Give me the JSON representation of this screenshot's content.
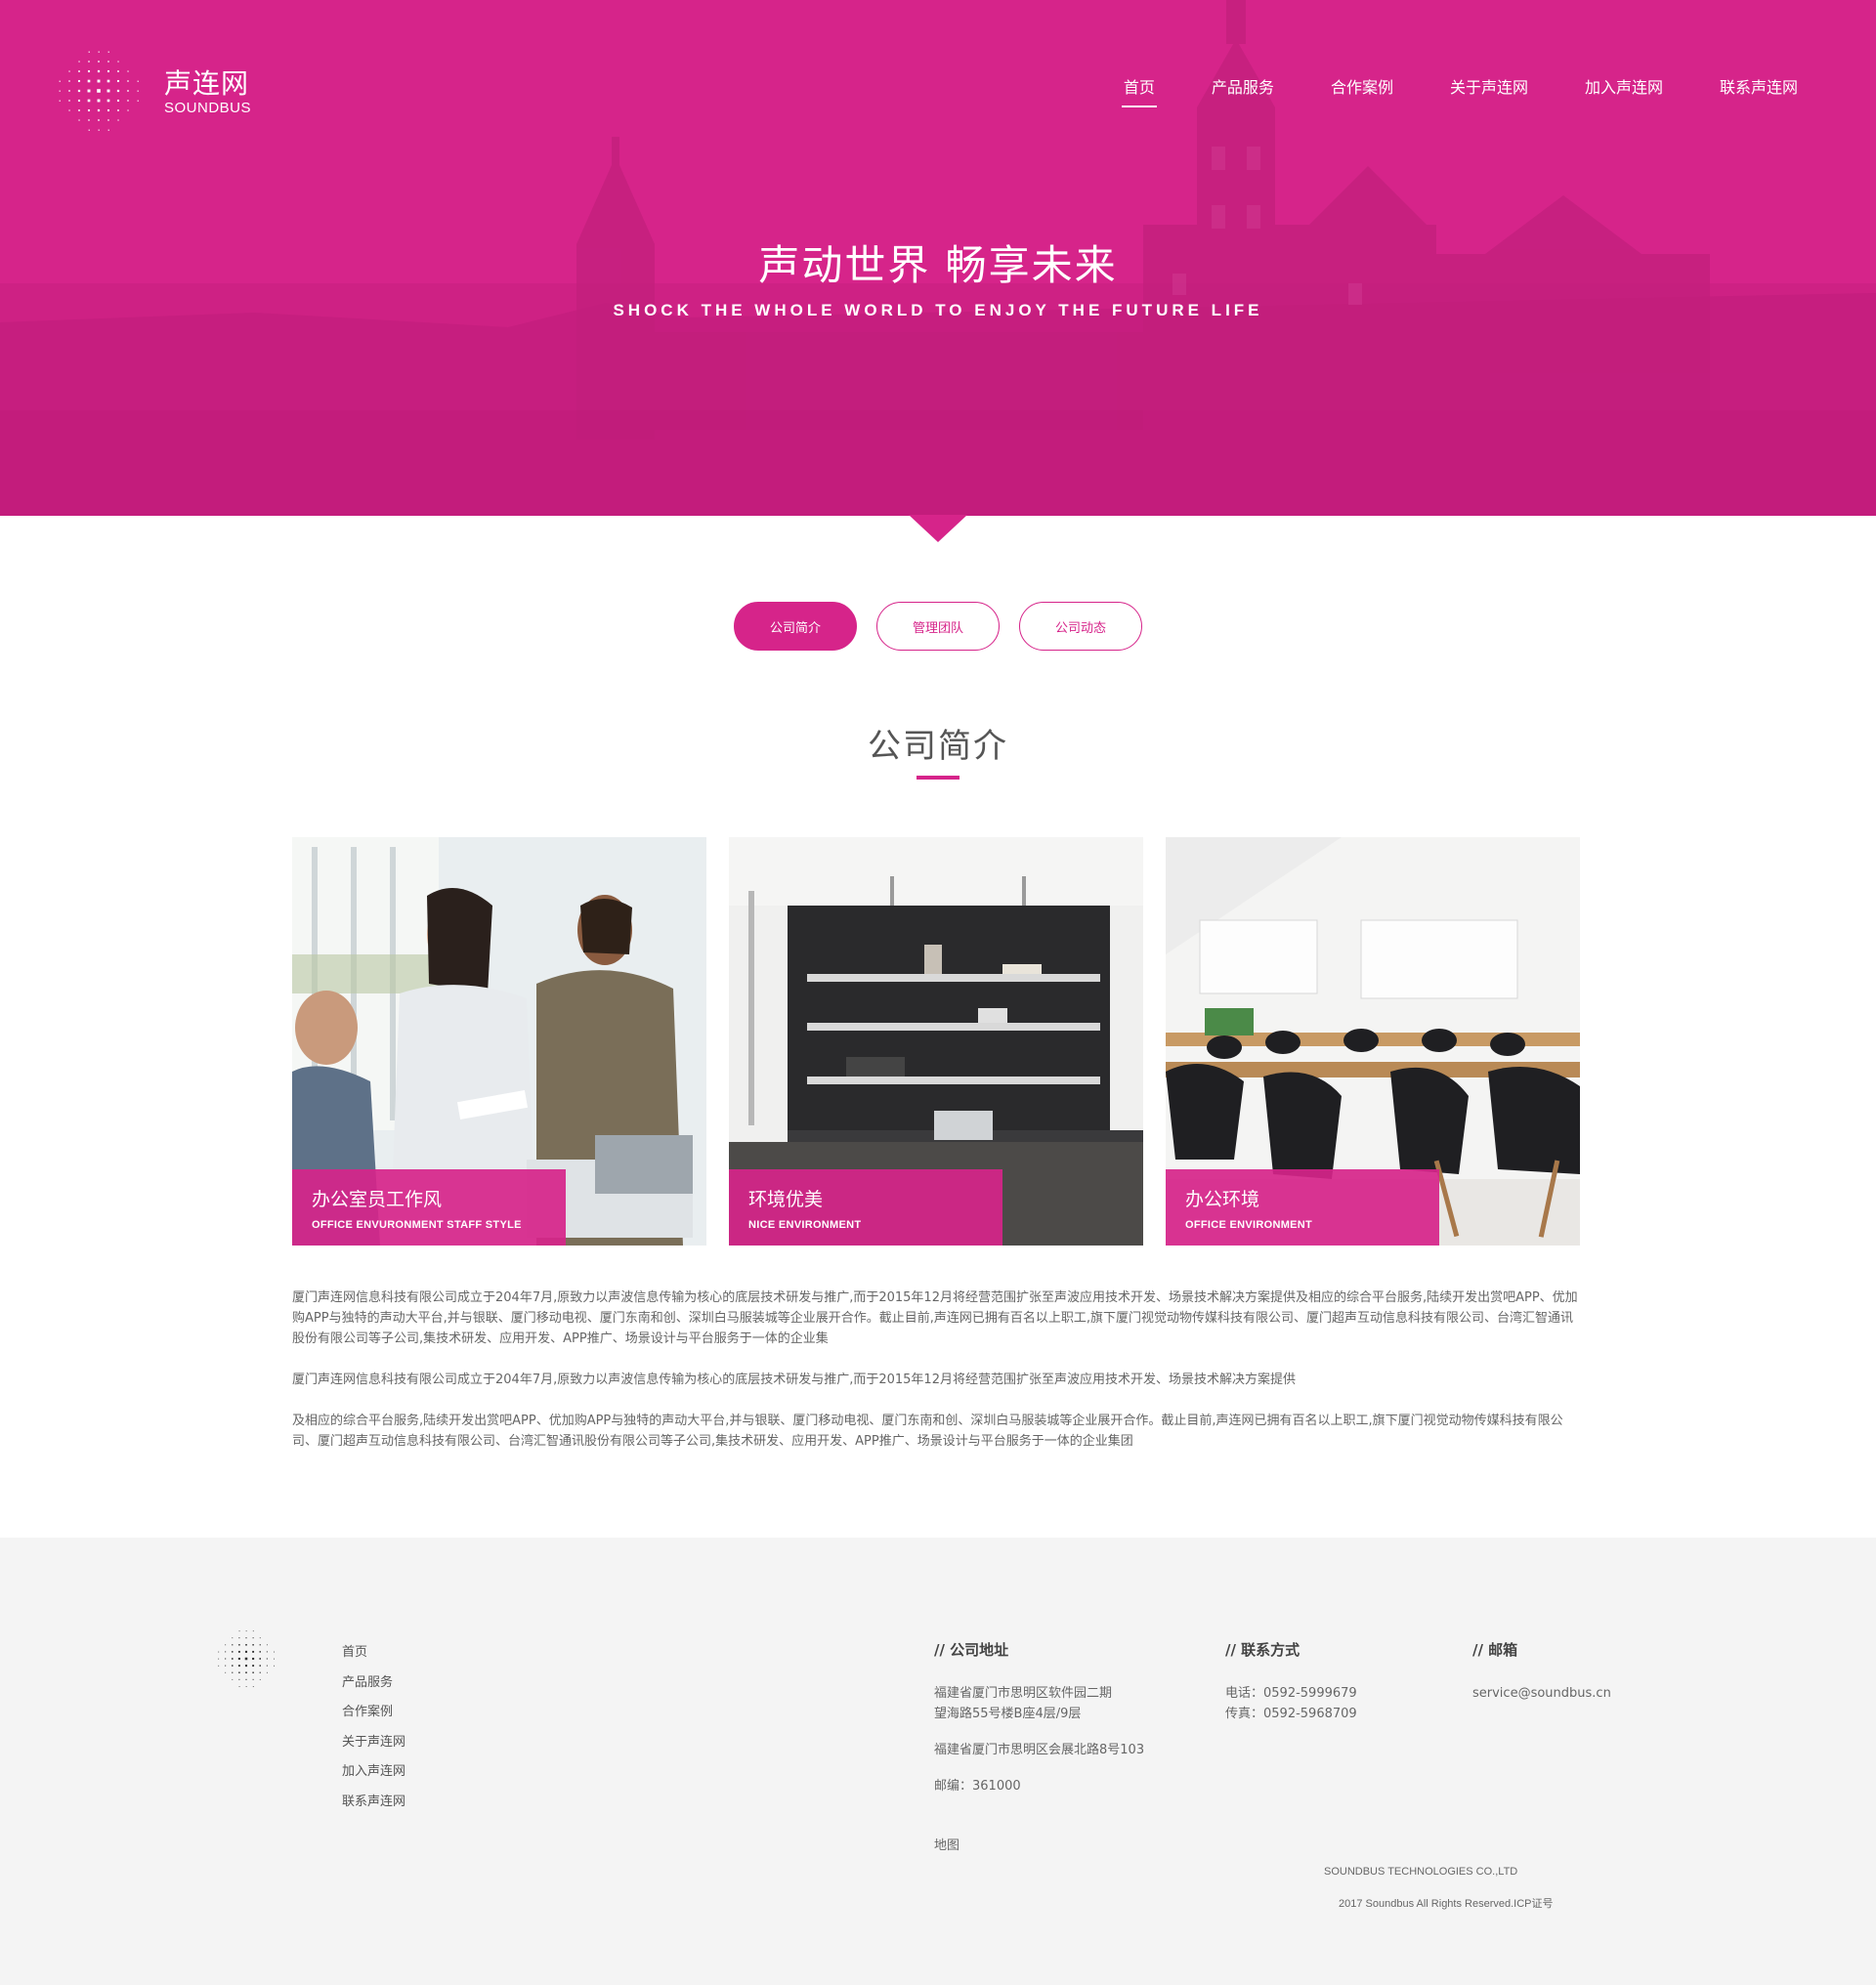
{
  "brand": {
    "name_cn": "声连网",
    "name_en": "SOUNDBUS"
  },
  "nav": [
    {
      "label": "首页",
      "active": true
    },
    {
      "label": "产品服务"
    },
    {
      "label": "合作案例"
    },
    {
      "label": "关于声连网"
    },
    {
      "label": "加入声连网"
    },
    {
      "label": "联系声连网"
    }
  ],
  "hero": {
    "title": "声动世界 畅享未来",
    "subtitle": "SHOCK THE WHOLE WORLD TO  ENJOY THE FUTURE LIFE"
  },
  "tabs": [
    "公司简介",
    "管理团队",
    "公司动态"
  ],
  "section_title": "公司简介",
  "cards": [
    {
      "title": "办公室员工作风",
      "subtitle": "OFFICE ENVURONMENT STAFF STYLE"
    },
    {
      "title": "环境优美",
      "subtitle": "NICE ENVIRONMENT"
    },
    {
      "title": "办公环境",
      "subtitle": "OFFICE ENVIRONMENT"
    }
  ],
  "paragraphs": [
    "厦门声连网信息科技有限公司成立于204年7月,原致力以声波信息传输为核心的底层技术研发与推广,而于2015年12月将经营范围扩张至声波应用技术开发、场景技术解决方案提供及相应的综合平台服务,陆续开发出赏吧APP、优加购APP与独特的声动大平台,并与银联、厦门移动电视、厦门东南和创、深圳白马服装城等企业展开合作。截止目前,声连网已拥有百名以上职工,旗下厦门视觉动物传媒科技有限公司、厦门超声互动信息科技有限公司、台湾汇智通讯股份有限公司等子公司,集技术研发、应用开发、APP推广、场景设计与平台服务于一体的企业集",
    "厦门声连网信息科技有限公司成立于204年7月,原致力以声波信息传输为核心的底层技术研发与推广,而于2015年12月将经营范围扩张至声波应用技术开发、场景技术解决方案提供",
    "及相应的综合平台服务,陆续开发出赏吧APP、优加购APP与独特的声动大平台,并与银联、厦门移动电视、厦门东南和创、深圳白马服装城等企业展开合作。截止目前,声连网已拥有百名以上职工,旗下厦门视觉动物传媒科技有限公司、厦门超声互动信息科技有限公司、台湾汇智通讯股份有限公司等子公司,集技术研发、应用开发、APP推广、场景设计与平台服务于一体的企业集团"
  ],
  "footer": {
    "nav": [
      "首页",
      "产品服务",
      "合作案例",
      "关于声连网",
      "加入声连网",
      "联系声连网"
    ],
    "address": {
      "heading": "// 公司地址",
      "line1": "福建省厦门市思明区软件园二期",
      "line2": "望海路55号楼B座4层/9层",
      "line3": "福建省厦门市思明区会展北路8号103",
      "postcode": "邮编：361000",
      "map": "地图"
    },
    "contact": {
      "heading": "// 联系方式",
      "phone": "电话：0592-5999679",
      "fax": "传真：0592-5968709"
    },
    "email": {
      "heading": "// 邮箱",
      "value": "service@soundbus.cn"
    },
    "company": "SOUNDBUS TECHNOLOGIES CO.,LTD",
    "copyright": "2017 Soundbus All Rights Reserved.ICP证号"
  },
  "colors": {
    "brand": "#d6248a",
    "footer_bg": "#f4f4f4"
  }
}
